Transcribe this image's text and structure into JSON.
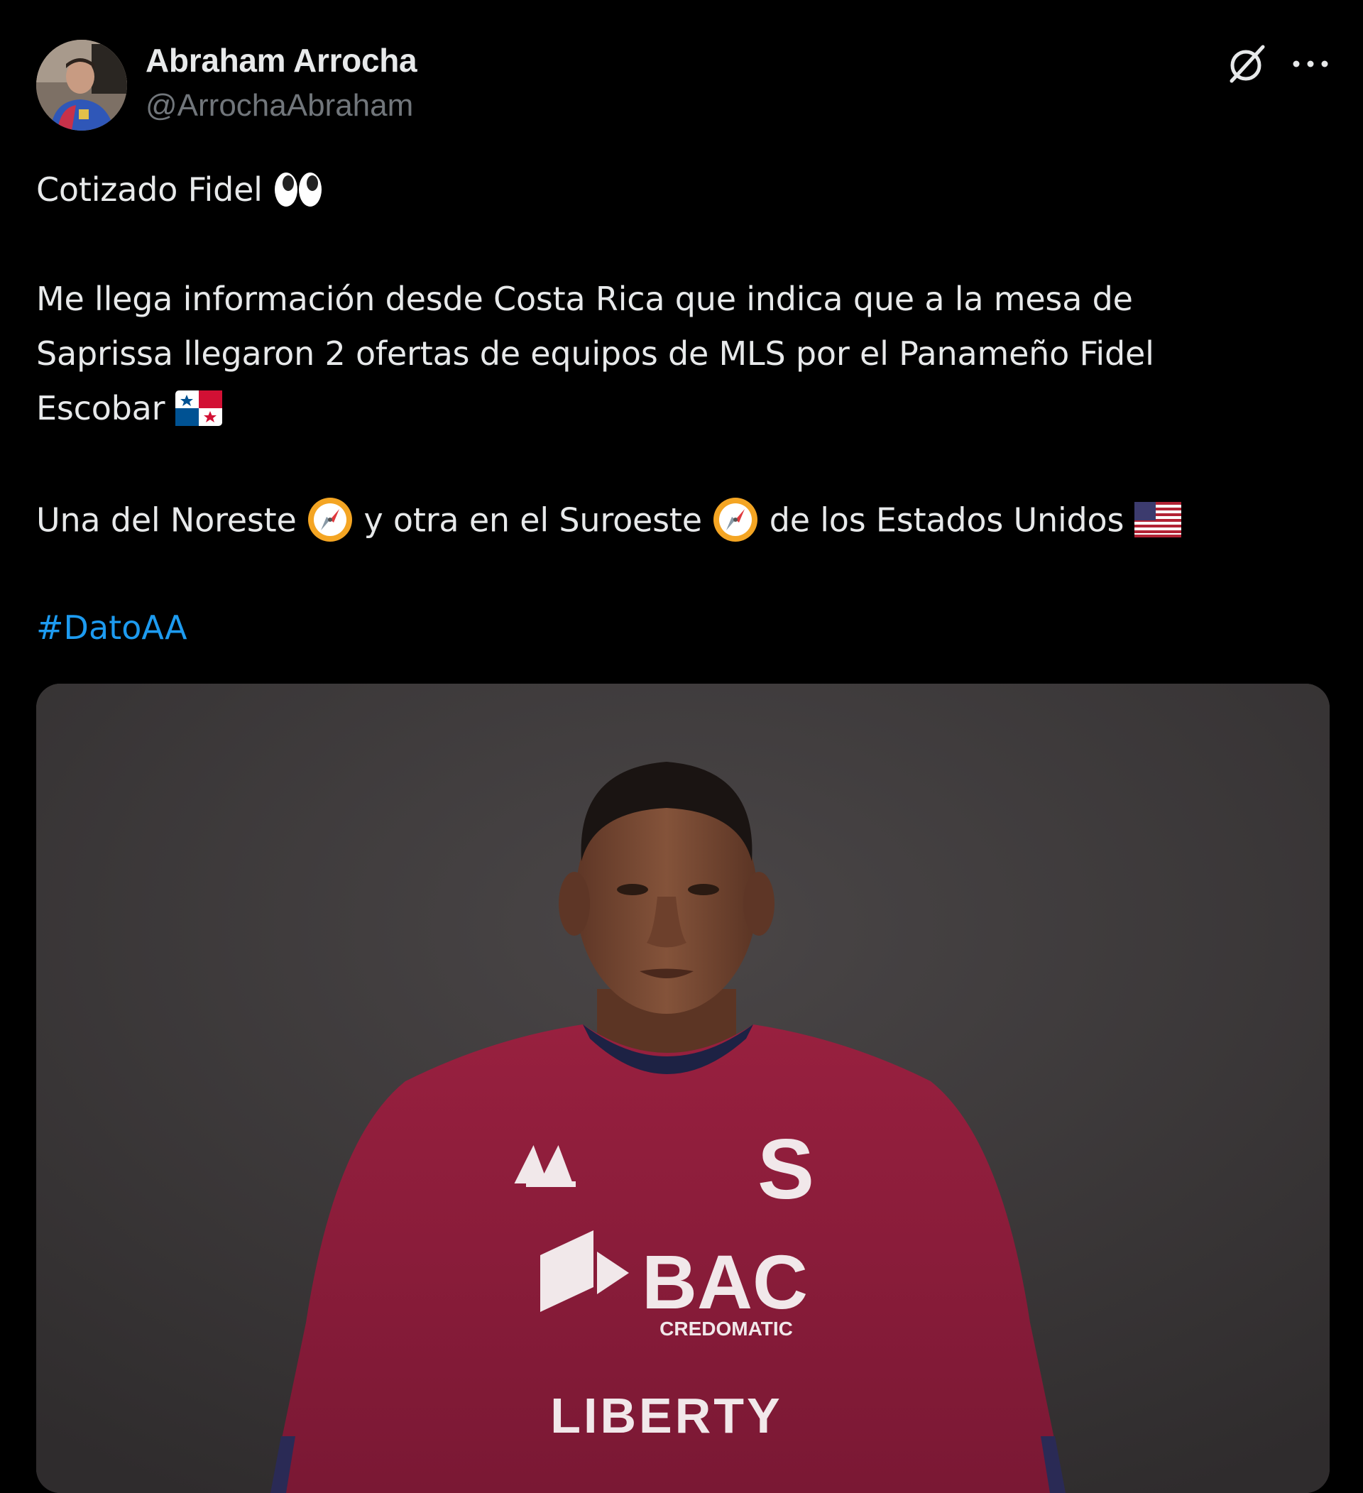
{
  "post": {
    "author": {
      "display_name": "Abraham Arrocha",
      "handle": "@ArrochaAbraham",
      "avatar_icon": "avatar"
    },
    "header_actions": {
      "grok_icon": "grok-icon",
      "more_icon": "more-options-icon"
    },
    "text": {
      "line1": "Cotizado Fidel",
      "line1_emoji": "eyes",
      "line2": "Me llega información desde Costa Rica que indica que a la mesa de",
      "line3": "Saprissa llegaron 2 ofertas de equipos de MLS por el Panameño Fidel",
      "line4": "Escobar",
      "line4_emoji": "flag-panama",
      "line5_part1": "Una del Noreste",
      "line5_part2": "y otra en el Suroeste",
      "line5_part3": "de los Estados Unidos",
      "line5_emojis": [
        "compass",
        "compass",
        "flag-united-states"
      ],
      "hashtag": "#DatoAA"
    },
    "media": {
      "kind": "photo",
      "jersey_brand_text": "BAC",
      "jersey_brand_sub": "CREDOMATIC",
      "jersey_sponsor": "LIBERTY",
      "jersey_crest": "S",
      "colors": {
        "background": "#3f3c3d",
        "jersey": "#8c1d3c",
        "skin": "#7a4a33",
        "hair": "#1a1412"
      }
    }
  },
  "colors": {
    "background": "#000000",
    "text": "#e7e9ea",
    "secondary_text": "#71767b",
    "link": "#1d9bf0"
  }
}
